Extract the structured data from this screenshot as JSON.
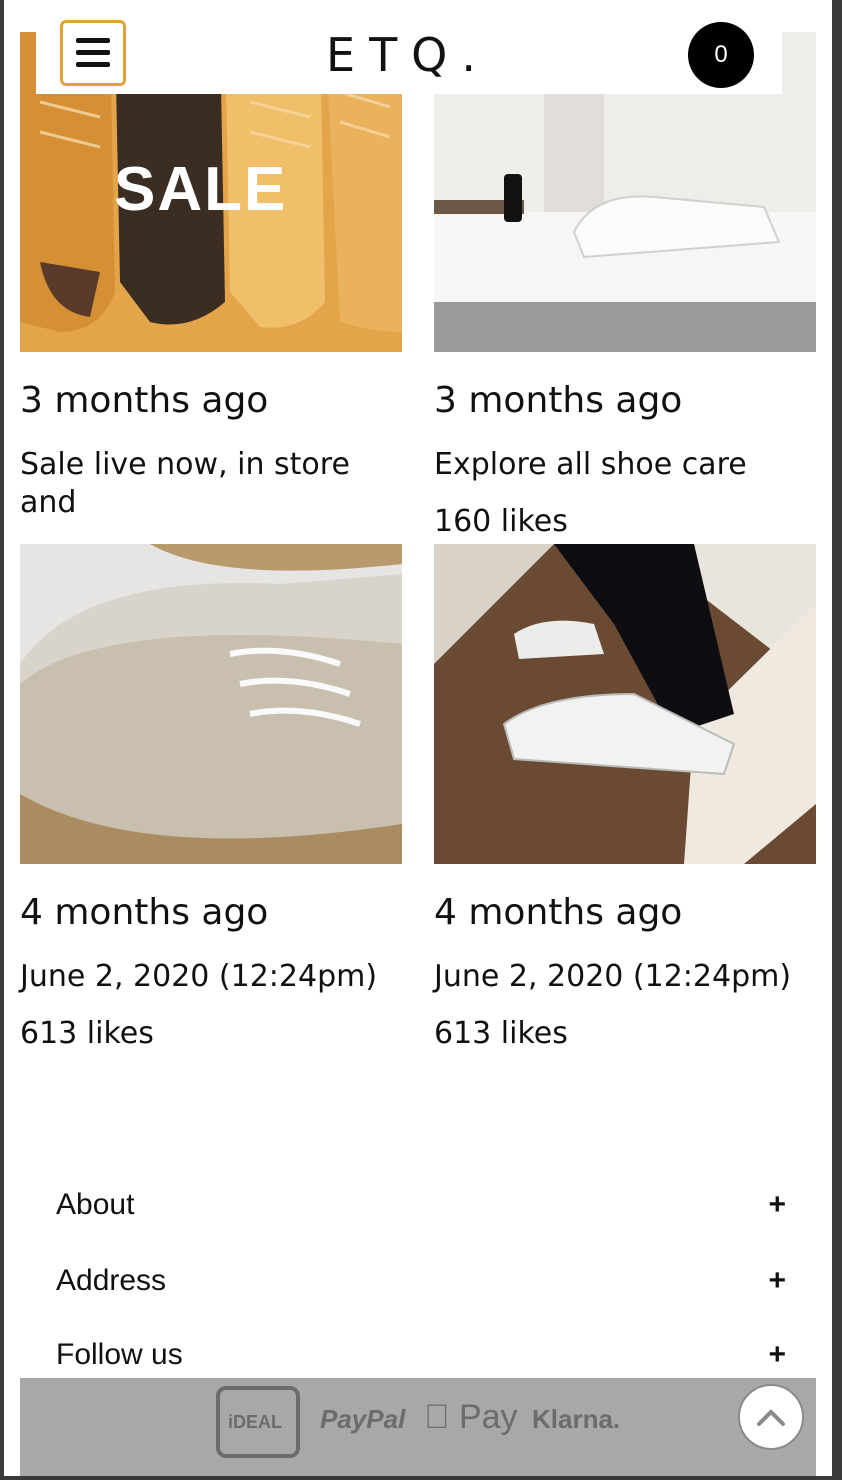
{
  "header": {
    "logo": "ETQ.",
    "cart_count": "0"
  },
  "posts": [
    {
      "overlay": "SALE",
      "time": "3 months ago",
      "text": "Sale live now, in store and",
      "likes": ""
    },
    {
      "overlay": "",
      "time": "3 months ago",
      "text": "Explore all shoe care",
      "likes": "160 likes"
    },
    {
      "overlay": "",
      "time": "4 months ago",
      "text": "June 2, 2020 (12:24pm)",
      "likes": "613 likes"
    },
    {
      "overlay": "",
      "time": "4 months ago",
      "text": "June 2, 2020 (12:24pm)",
      "likes": "613 likes"
    }
  ],
  "footer": {
    "sections": [
      {
        "label": "About",
        "toggle": "+"
      },
      {
        "label": "Address",
        "toggle": "+"
      },
      {
        "label": "Follow us",
        "toggle": "+"
      }
    ]
  },
  "payments": {
    "ideal": "iDEAL",
    "paypal": "PayPal",
    "applepay": "Pay",
    "klarna": "Klarna."
  },
  "colors": {
    "menu_border": "#e0a23a",
    "sale_bg": "#e2a34a",
    "payment_bg": "#a8a8a8"
  },
  "icons": [
    "hamburger-menu-icon",
    "cart-icon",
    "apple-icon",
    "chevron-up-icon"
  ]
}
